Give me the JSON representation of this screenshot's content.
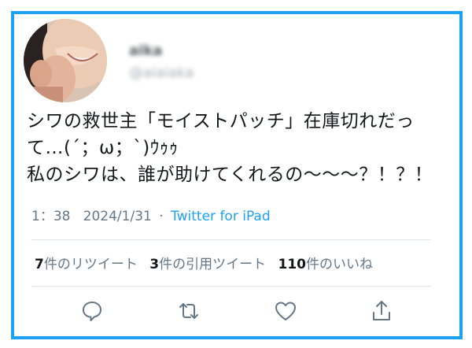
{
  "tweet": {
    "author": {
      "display_name": "aika",
      "handle": "@aiaiaka"
    },
    "text_lines": [
      "シワの救世主「モイストパッチ」在庫切れだっ",
      "て…(´；ω；`)ｳｩｩ",
      "私のシワは、誰が助けてくれるの〜〜〜？！？！"
    ],
    "time": "1：38",
    "date": "2024/1/31",
    "separator": "·",
    "client": "Twitter for iPad"
  },
  "stats": {
    "retweets_count": "7",
    "retweets_label": "件のリツイート",
    "quotes_count": "3",
    "quotes_label": "件の引用ツイート",
    "likes_count": "110",
    "likes_label": "件のいいね"
  },
  "actions": [
    "reply-icon",
    "retweet-icon",
    "like-icon",
    "share-icon"
  ],
  "colors": {
    "border": "#1da1f2",
    "link": "#1da1f2",
    "text": "#14171a",
    "secondary": "#657786",
    "divider": "#e1e8ed"
  }
}
